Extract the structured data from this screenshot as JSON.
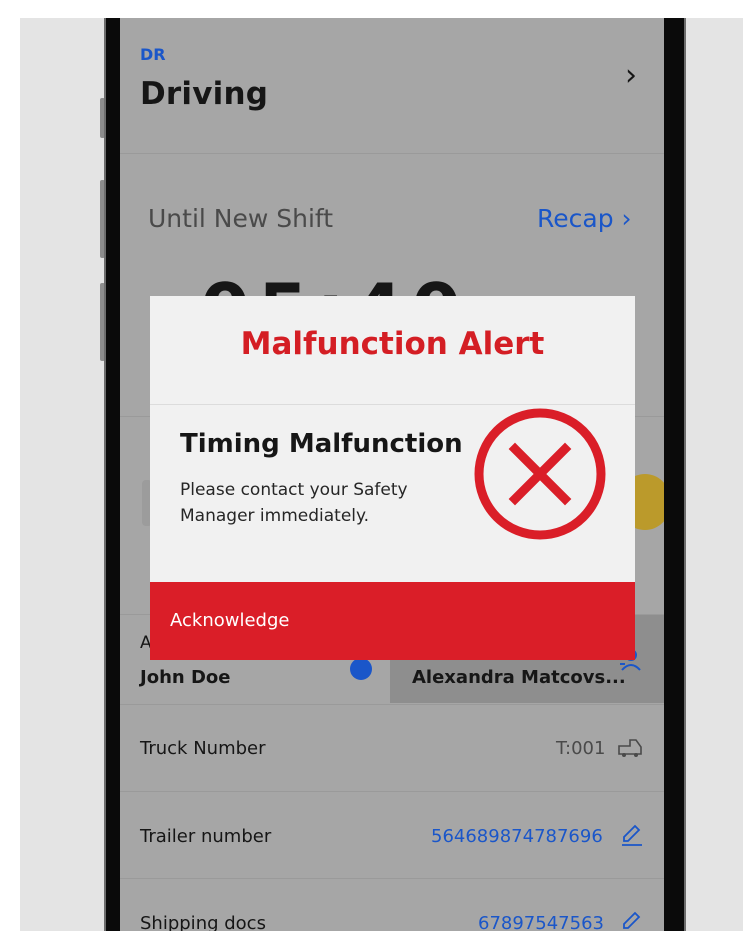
{
  "header": {
    "status_code": "DR",
    "status_title": "Driving"
  },
  "clock": {
    "label": "Until New Shift",
    "recap_label": "Recap",
    "time_visible": "05:40"
  },
  "drivers": {
    "driver_label": "A",
    "driver_name": "John Doe",
    "codriver_name": "Alexandra Matcovs..."
  },
  "rows": {
    "truck_label": "Truck Number",
    "truck_value": "T:001",
    "trailer_label": "Trailer number",
    "trailer_value": "564689874787696",
    "shipping_label": "Shipping docs",
    "shipping_value": "67897547563"
  },
  "modal": {
    "title": "Malfunction Alert",
    "heading": "Timing Malfunction",
    "message": "Please contact your Safety Manager immediately.",
    "action_label": "Acknowledge",
    "icon": "error-circle-x-icon"
  },
  "colors": {
    "alert_red": "#da1e28",
    "link_blue": "#1a56c9",
    "overlay_gray": "#a6a6a6",
    "modal_bg": "#f1f1f1"
  }
}
